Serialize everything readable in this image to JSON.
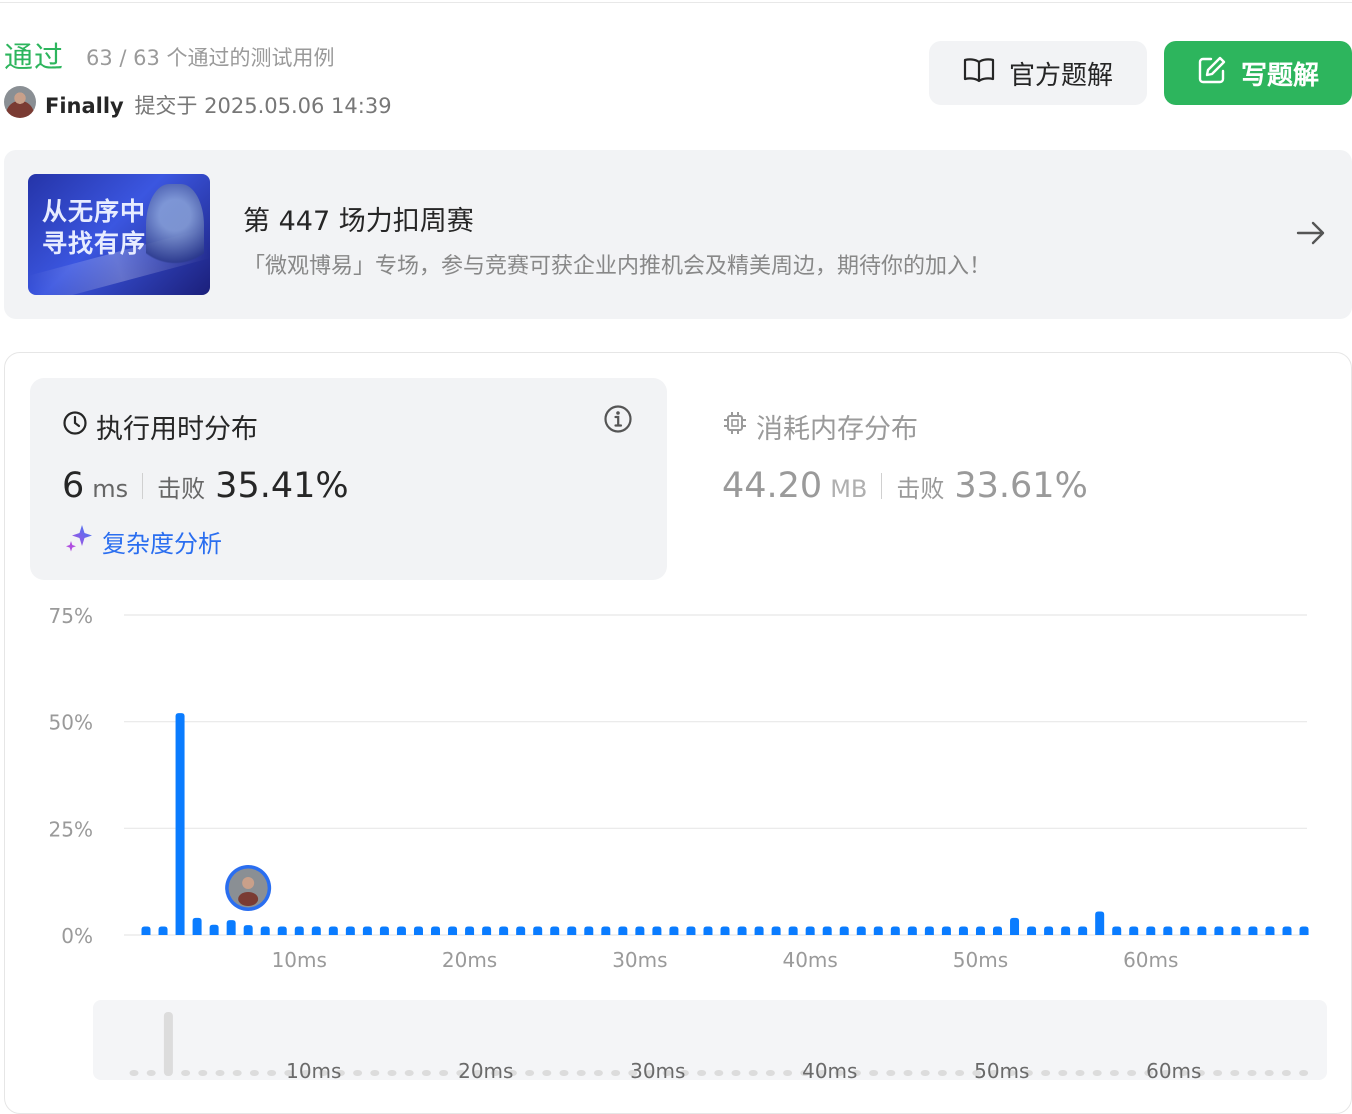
{
  "header": {
    "status": "通过",
    "cases": "63 / 63 个通过的测试用例",
    "user": "Finally",
    "submitted_prefix": "提交于",
    "submitted_time": "2025.05.06 14:39",
    "official_button": "官方题解",
    "write_button": "写题解",
    "accent_color": "#2db55d"
  },
  "banner": {
    "image_line1": "从无序中",
    "image_line2": "寻找有序",
    "title": "第 447 场力扣周赛",
    "subtitle": "「微观博易」专场，参与竞赛可获企业内推机会及精美周边，期待你的加入！"
  },
  "runtime": {
    "title": "执行用时分布",
    "value": "6",
    "unit": "ms",
    "beat_label": "击败",
    "beat_value": "35.41%",
    "complexity_link": "复杂度分析"
  },
  "memory": {
    "title": "消耗内存分布",
    "value": "44.20",
    "unit": "MB",
    "beat_label": "击败",
    "beat_value": "33.61%"
  },
  "chart_data": {
    "type": "bar",
    "ylabel": "",
    "ylim": [
      0,
      75
    ],
    "yticks": [
      "0%",
      "25%",
      "50%",
      "75%"
    ],
    "x_start_ms": 1,
    "x_end_ms": 67,
    "xticks": [
      "10ms",
      "20ms",
      "30ms",
      "40ms",
      "50ms",
      "60ms"
    ],
    "bar_color": "#0a7cff",
    "highlight_ms": 6,
    "values": [
      2,
      2,
      52,
      4,
      2.4,
      3.5,
      2.3,
      2,
      2,
      2,
      2,
      2,
      2,
      2,
      2,
      2,
      2,
      2,
      2,
      2,
      2,
      2,
      2,
      2,
      2,
      2,
      2,
      2,
      2,
      2,
      2,
      2,
      2,
      2,
      2,
      2,
      2,
      2,
      2,
      2,
      2,
      2,
      2,
      2,
      2,
      2,
      2,
      2,
      2,
      2,
      2,
      4,
      2,
      2,
      2,
      2,
      5.5,
      2,
      2,
      2,
      2,
      2,
      2,
      2,
      2,
      2,
      2,
      2,
      2
    ]
  },
  "navigator": {
    "xticks": [
      "10ms",
      "20ms",
      "30ms",
      "40ms",
      "50ms",
      "60ms"
    ]
  }
}
